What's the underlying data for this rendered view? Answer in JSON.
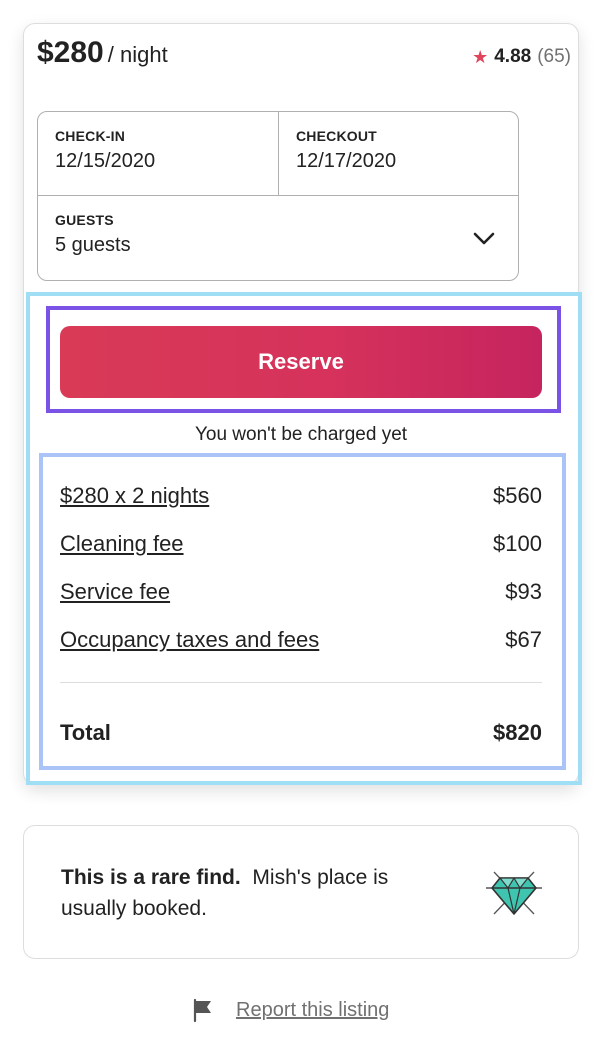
{
  "listing": {
    "price": "$280",
    "per_night": "/ night",
    "rating": "4.88",
    "review_count": "(65)"
  },
  "booking": {
    "checkin_label": "CHECK-IN",
    "checkin_value": "12/15/2020",
    "checkout_label": "CHECKOUT",
    "checkout_value": "12/17/2020",
    "guests_label": "GUESTS",
    "guests_value": "5 guests"
  },
  "reserve": {
    "button_label": "Reserve",
    "note": "You won't be charged yet"
  },
  "fees": [
    {
      "label": "$280 x 2 nights",
      "amount": "$560"
    },
    {
      "label": "Cleaning fee",
      "amount": "$100"
    },
    {
      "label": "Service fee",
      "amount": "$93"
    },
    {
      "label": "Occupancy taxes and fees",
      "amount": "$67"
    }
  ],
  "total": {
    "label": "Total",
    "amount": "$820"
  },
  "rare_find": {
    "headline": "This is a rare find.",
    "text": "Mish's place is usually booked."
  },
  "report": {
    "link_label": "Report this listing"
  },
  "icons": {
    "rating": "star-icon",
    "guests_toggle": "chevron-down-icon",
    "rare": "diamond-icon",
    "report": "flag-icon"
  },
  "colors": {
    "brand": "#d93a56",
    "brand_end": "#c5245e",
    "star": "#e0455c",
    "muted_text": "#717171",
    "diamond": "#3fc4b0"
  }
}
